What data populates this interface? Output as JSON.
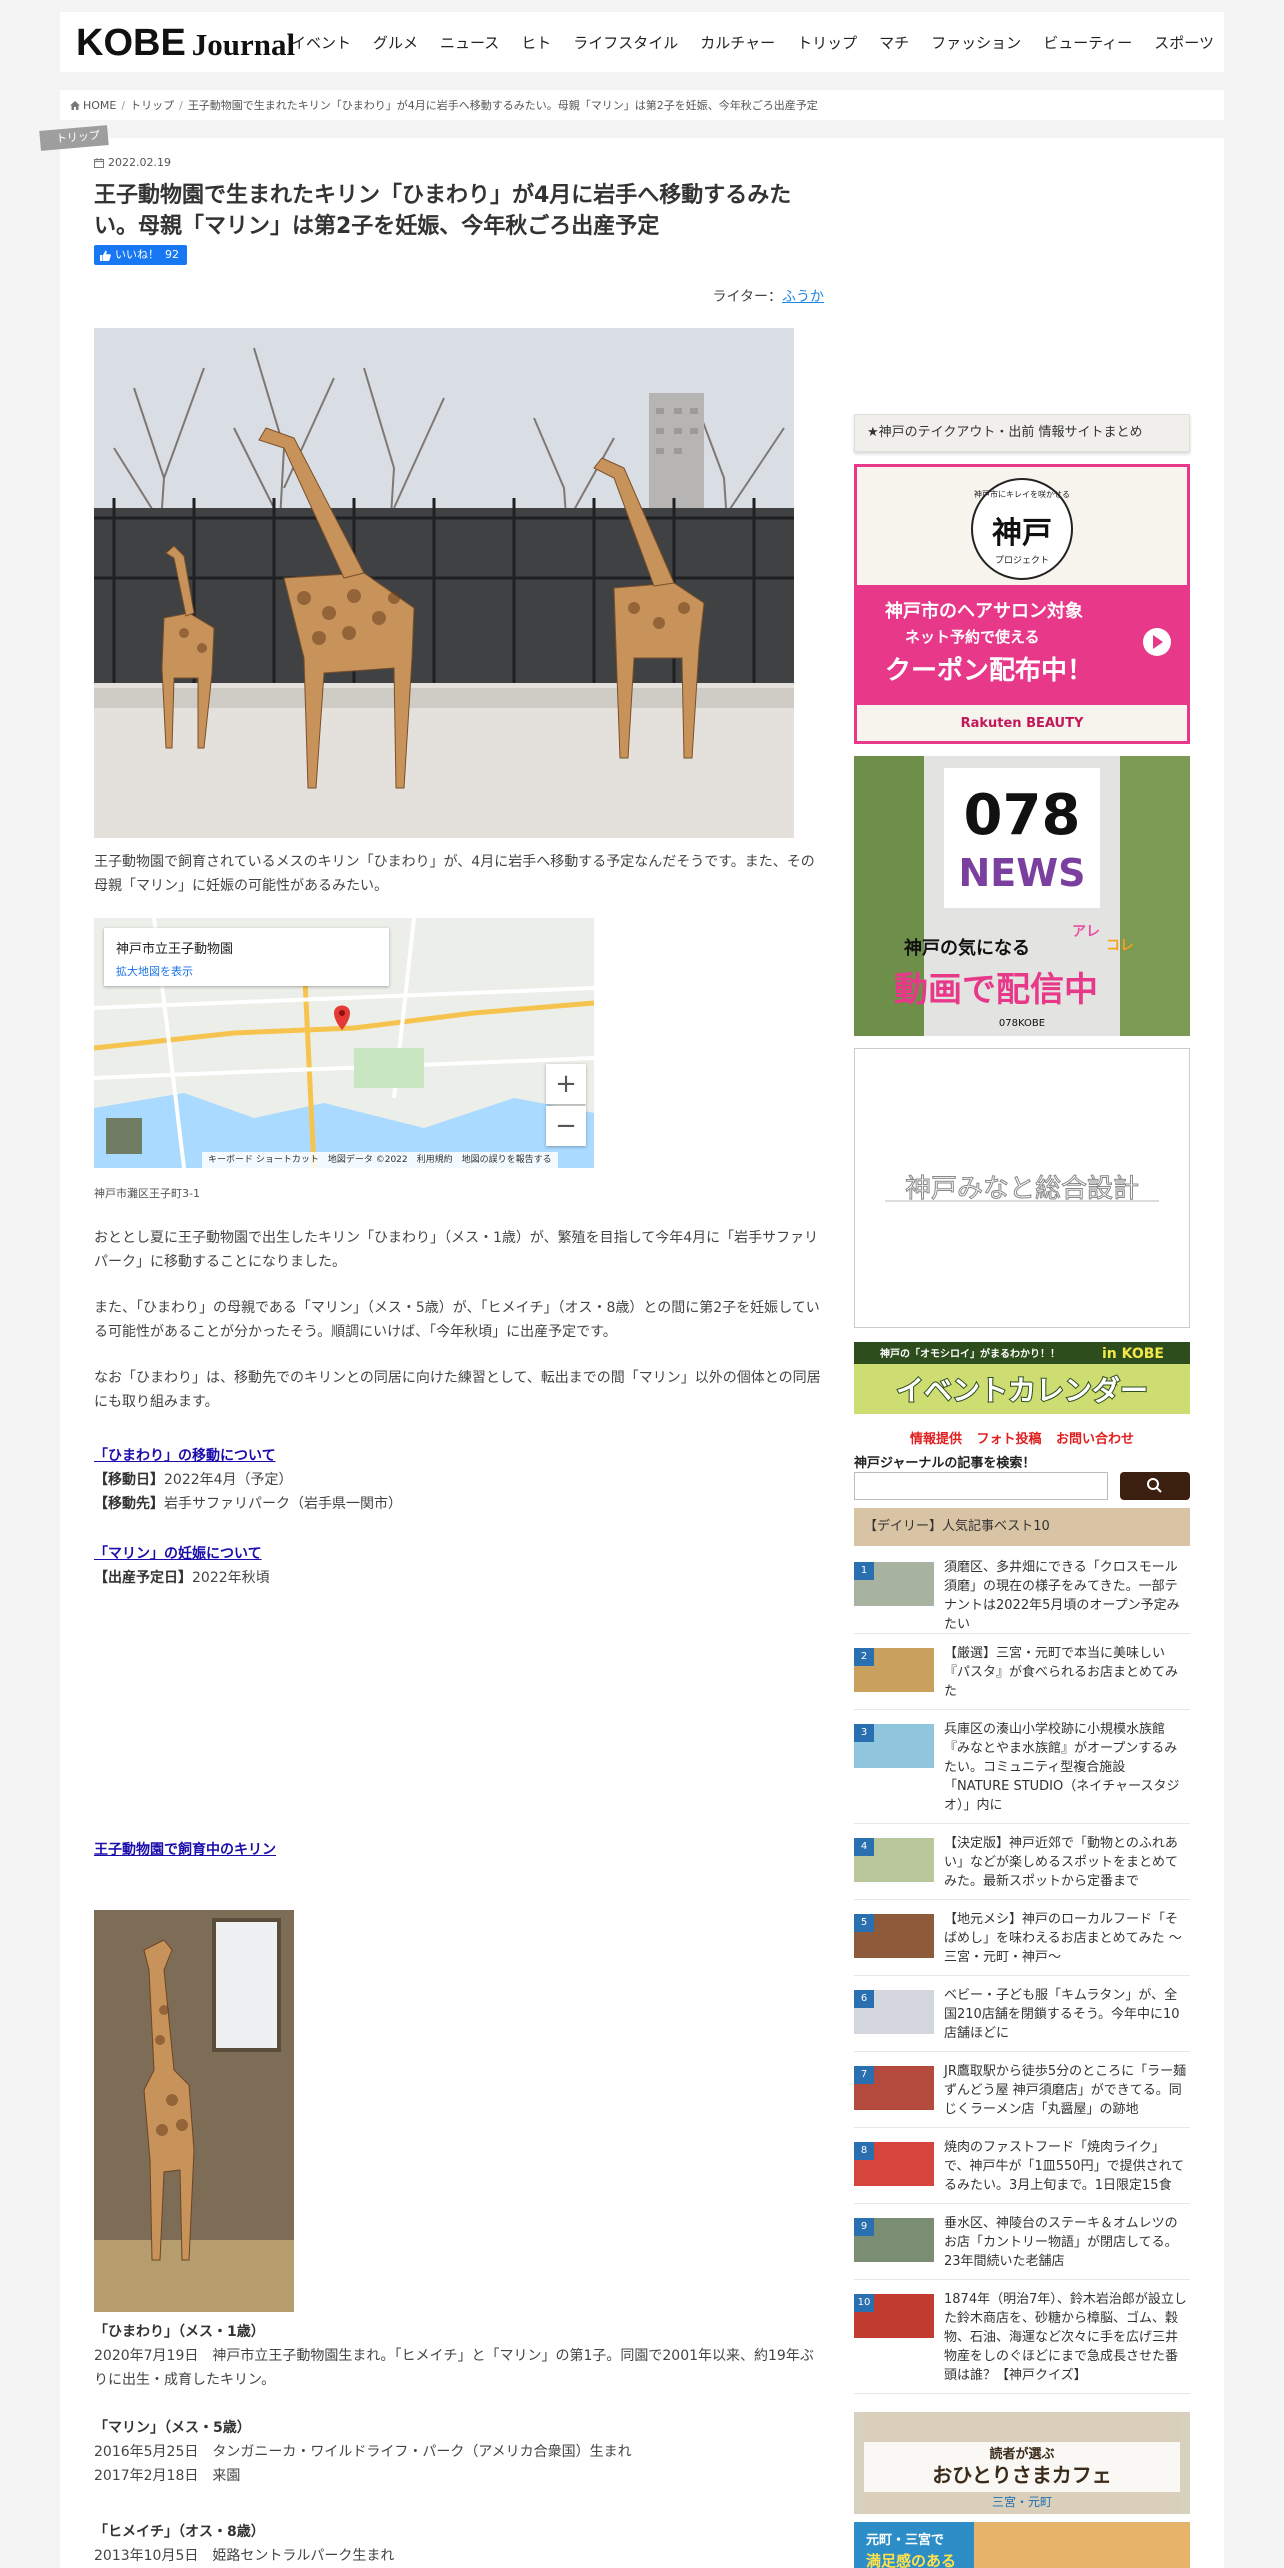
{
  "site": {
    "logo_main": "KOBE",
    "logo_sub": "Journal",
    "nav": [
      "イベント",
      "グルメ",
      "ニュース",
      "ヒト",
      "ライフスタイル",
      "カルチャー",
      "トリップ",
      "マチ",
      "ファッション",
      "ビューティー",
      "スポーツ"
    ]
  },
  "breadcrumb": [
    "HOME",
    "トリップ",
    "王子動物園で生まれたキリン「ひまわり」が4月に岩手へ移動するみたい。母親「マリン」は第2子を妊娠、今年秋ごろ出産予定"
  ],
  "article": {
    "category": "トリップ",
    "date": "2022.02.19",
    "title": "王子動物園で生まれたキリン「ひまわり」が4月に岩手へ移動するみたい。母親「マリン」は第2子を妊娠、今年秋ごろ出産予定",
    "like_label": "いいね！",
    "like_count": "92",
    "writer_label": "ライター：",
    "writer_name": "ふうか",
    "intro": "王子動物園で飼育されているメスのキリン「ひまわり」が、4月に岩手へ移動する予定なんだそうです。また、その母親「マリン」に妊娠の可能性があるみたい。",
    "map": {
      "place_name": "神戸市立王子動物園",
      "enlarge_link": "拡大地図を表示",
      "footer": "キーボード ショートカット　地図データ ©2022　利用規約　地図の誤りを報告する",
      "zoom_in": "+",
      "zoom_out": "−"
    },
    "address": "神戸市灘区王子町3-1",
    "para1": "おととし夏に王子動物園で出生したキリン「ひまわり」（メス・1歳）が、繁殖を目指して今年4月に「岩手サファリパーク」に移動することになりました。",
    "para2": "また、「ひまわり」の母親である「マリン」（メス・5歳）が、「ヒメイチ」（オス・8歳）との間に第2子を妊娠している可能性があることが分かったそう。順調にいけば、「今年秋頃」に出産予定です。",
    "para3": "なお「ひまわり」は、移動先でのキリンとの同居に向けた練習として、転出までの間「マリン」以外の個体との同居にも取り組みます。",
    "move_heading": "「ひまわり」の移動について",
    "move_date_label": "【移動日】",
    "move_date": "2022年4月（予定）",
    "move_dest_label": "【移動先】",
    "move_dest": "岩手サファリパーク（岩手県一関市）",
    "preg_heading": "「マリン」の妊娠について",
    "birth_label": "【出産予定日】",
    "birth_date": "2022年秋頃",
    "giraffes_heading": "王子動物園で飼育中のキリン",
    "himawari_title": "「ひまわり」（メス・1歳）",
    "himawari_text": "2020年7月19日　神戸市立王子動物園生まれ。「ヒメイチ」と「マリン」の第1子。同園で2001年以来、約19年ぶりに出生・成育したキリン。",
    "marin_title": "「マリン」（メス・5歳）",
    "marin_line1": "2016年5月25日　タンガニーカ・ワイルドライフ・パーク（アメリカ合衆国）生まれ",
    "marin_line2": "2017年2月18日　来園",
    "himeichi_title": "「ヒメイチ」（オス・8歳）",
    "himeichi_line1": "2013年10月5日　姫路セントラルパーク生まれ"
  },
  "sidebar": {
    "head": "★神戸のテイクアウト・出前 情報サイトまとめ",
    "banner1": {
      "top": "神戸市にキレイを咲かせる",
      "logo": "神戸",
      "logo_sub": "プロジェクト",
      "line1": "神戸市のヘアサロン対象",
      "line2": "ネット予約で使える",
      "line3": "クーポン配布中！",
      "brand": "Rakuten BEAUTY"
    },
    "banner2": {
      "big": "078",
      "news": "NEWS",
      "line1": "神戸の気になる",
      "are": "アレ",
      "kore": "コレ",
      "line2": "動画で配信中",
      "foot": "078KOBE"
    },
    "banner3": {
      "text": "神戸みなと総合設計"
    },
    "banner4": {
      "top": "神戸の「オモシロイ」がまるわかり！！",
      "in_kobe": "in KOBE",
      "main": "イベントカレンダー"
    },
    "links": [
      "情報提供",
      "フォト投稿",
      "お問い合わせ"
    ],
    "search_label": "神戸ジャーナルの記事を検索！",
    "ranking_head": "【デイリー】人気記事ベスト10",
    "ranking": [
      {
        "num": "1",
        "text": "須磨区、多井畑にできる「クロスモール須磨」の現在の様子をみてきた。一部テナントは2022年5月頃のオープン予定みたい"
      },
      {
        "num": "2",
        "text": "【厳選】三宮・元町で本当に美味しい『パスタ』が食べられるお店まとめてみた"
      },
      {
        "num": "3",
        "text": "兵庫区の湊山小学校跡に小規模水族館『みなとやま水族館』がオープンするみたい。コミュニティ型複合施設「NATURE STUDIO（ネイチャースタジオ）」内に"
      },
      {
        "num": "4",
        "text": "【決定版】神戸近郊で「動物とのふれあい」などが楽しめるスポットをまとめてみた。最新スポットから定番まで"
      },
      {
        "num": "5",
        "text": "【地元メシ】神戸のローカルフード「そばめし」を味わえるお店まとめてみた ～三宮・元町・神戸～"
      },
      {
        "num": "6",
        "text": "ベビー・子ども服「キムラタン」が、全国210店舗を閉鎖するそう。今年中に10店舗ほどに"
      },
      {
        "num": "7",
        "text": "JR鷹取駅から徒歩5分のところに「ラー麺ずんどう屋 神戸須磨店」ができてる。同じくラーメン店「丸醤屋」の跡地"
      },
      {
        "num": "8",
        "text": "焼肉のファストフード「焼肉ライク」で、神戸牛が「1皿550円」で提供されてるみたい。3月上旬まで。1日限定15食"
      },
      {
        "num": "9",
        "text": "垂水区、神陵台のステーキ＆オムレツのお店「カントリー物語」が閉店してる。23年間続いた老舗店"
      },
      {
        "num": "10",
        "text": "1874年（明治7年）、鈴木岩治郎が設立した鈴木商店を、砂糖から樟脳、ゴム、穀物、石油、海運など次々に手を広げ三井物産をしのぐほどにまで急成長させた番頭は誰？【神戸クイズ】"
      }
    ],
    "banner5": {
      "line1": "読者が選ぶ",
      "line2": "おひとりさまカフェ",
      "line3": "三宮・元町"
    },
    "banner6": {
      "line1": "元町・三宮で",
      "line2": "満足感のある"
    }
  },
  "colors": {
    "accent": "#1a0dab",
    "like": "#1877f2",
    "rank_num": "#2a6fb0",
    "banner_pink": "#e8388a"
  }
}
